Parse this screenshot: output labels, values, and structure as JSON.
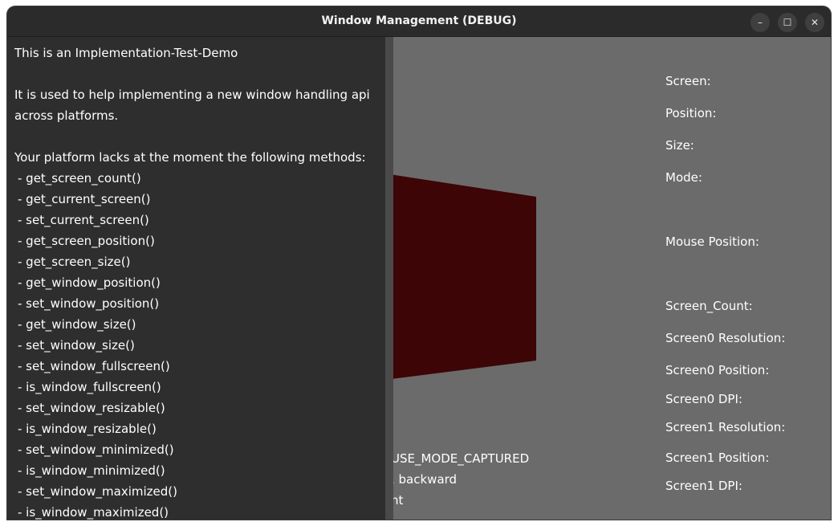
{
  "window": {
    "title": "Window Management (DEBUG)",
    "controls": {
      "minimize": "–",
      "maximize": "☐",
      "close": "✕"
    }
  },
  "left_panel": {
    "intro_line": "This is an Implementation-Test-Demo",
    "purpose_line_1": "It is used to help implementing a new window handling api",
    "purpose_line_2": "across platforms.",
    "lacks_line": "Your platform lacks at the moment the following methods:",
    "methods": [
      " - get_screen_count()",
      " - get_current_screen()",
      " - set_current_screen()",
      " - get_screen_position()",
      " - get_screen_size()",
      " - get_window_position()",
      " - set_window_position()",
      " - get_window_size()",
      " - set_window_size()",
      " - set_window_fullscreen()",
      " - is_window_fullscreen()",
      " - set_window_resizable()",
      " - is_window_resizable()",
      " - set_window_minimized()",
      " - is_window_minimized()",
      " - set_window_maximized()",
      " - is_window_maximized()"
    ]
  },
  "viewport": {
    "quad_color": "#3d0506",
    "status_lines": [
      "USE_MODE_CAPTURED",
      ", backward",
      "nt"
    ]
  },
  "right_labels": {
    "screen": "Screen:",
    "position": "Position:",
    "size": "Size:",
    "mode": "Mode:",
    "mouse_position": "Mouse Position:",
    "screen_count": "Screen_Count:",
    "screen0_resolution": "Screen0 Resolution:",
    "screen0_position": "Screen0 Position:",
    "screen0_dpi": "Screen0 DPI:",
    "screen1_resolution": "Screen1 Resolution:",
    "screen1_position": "Screen1 Position:",
    "screen1_dpi": "Screen1 DPI:"
  }
}
